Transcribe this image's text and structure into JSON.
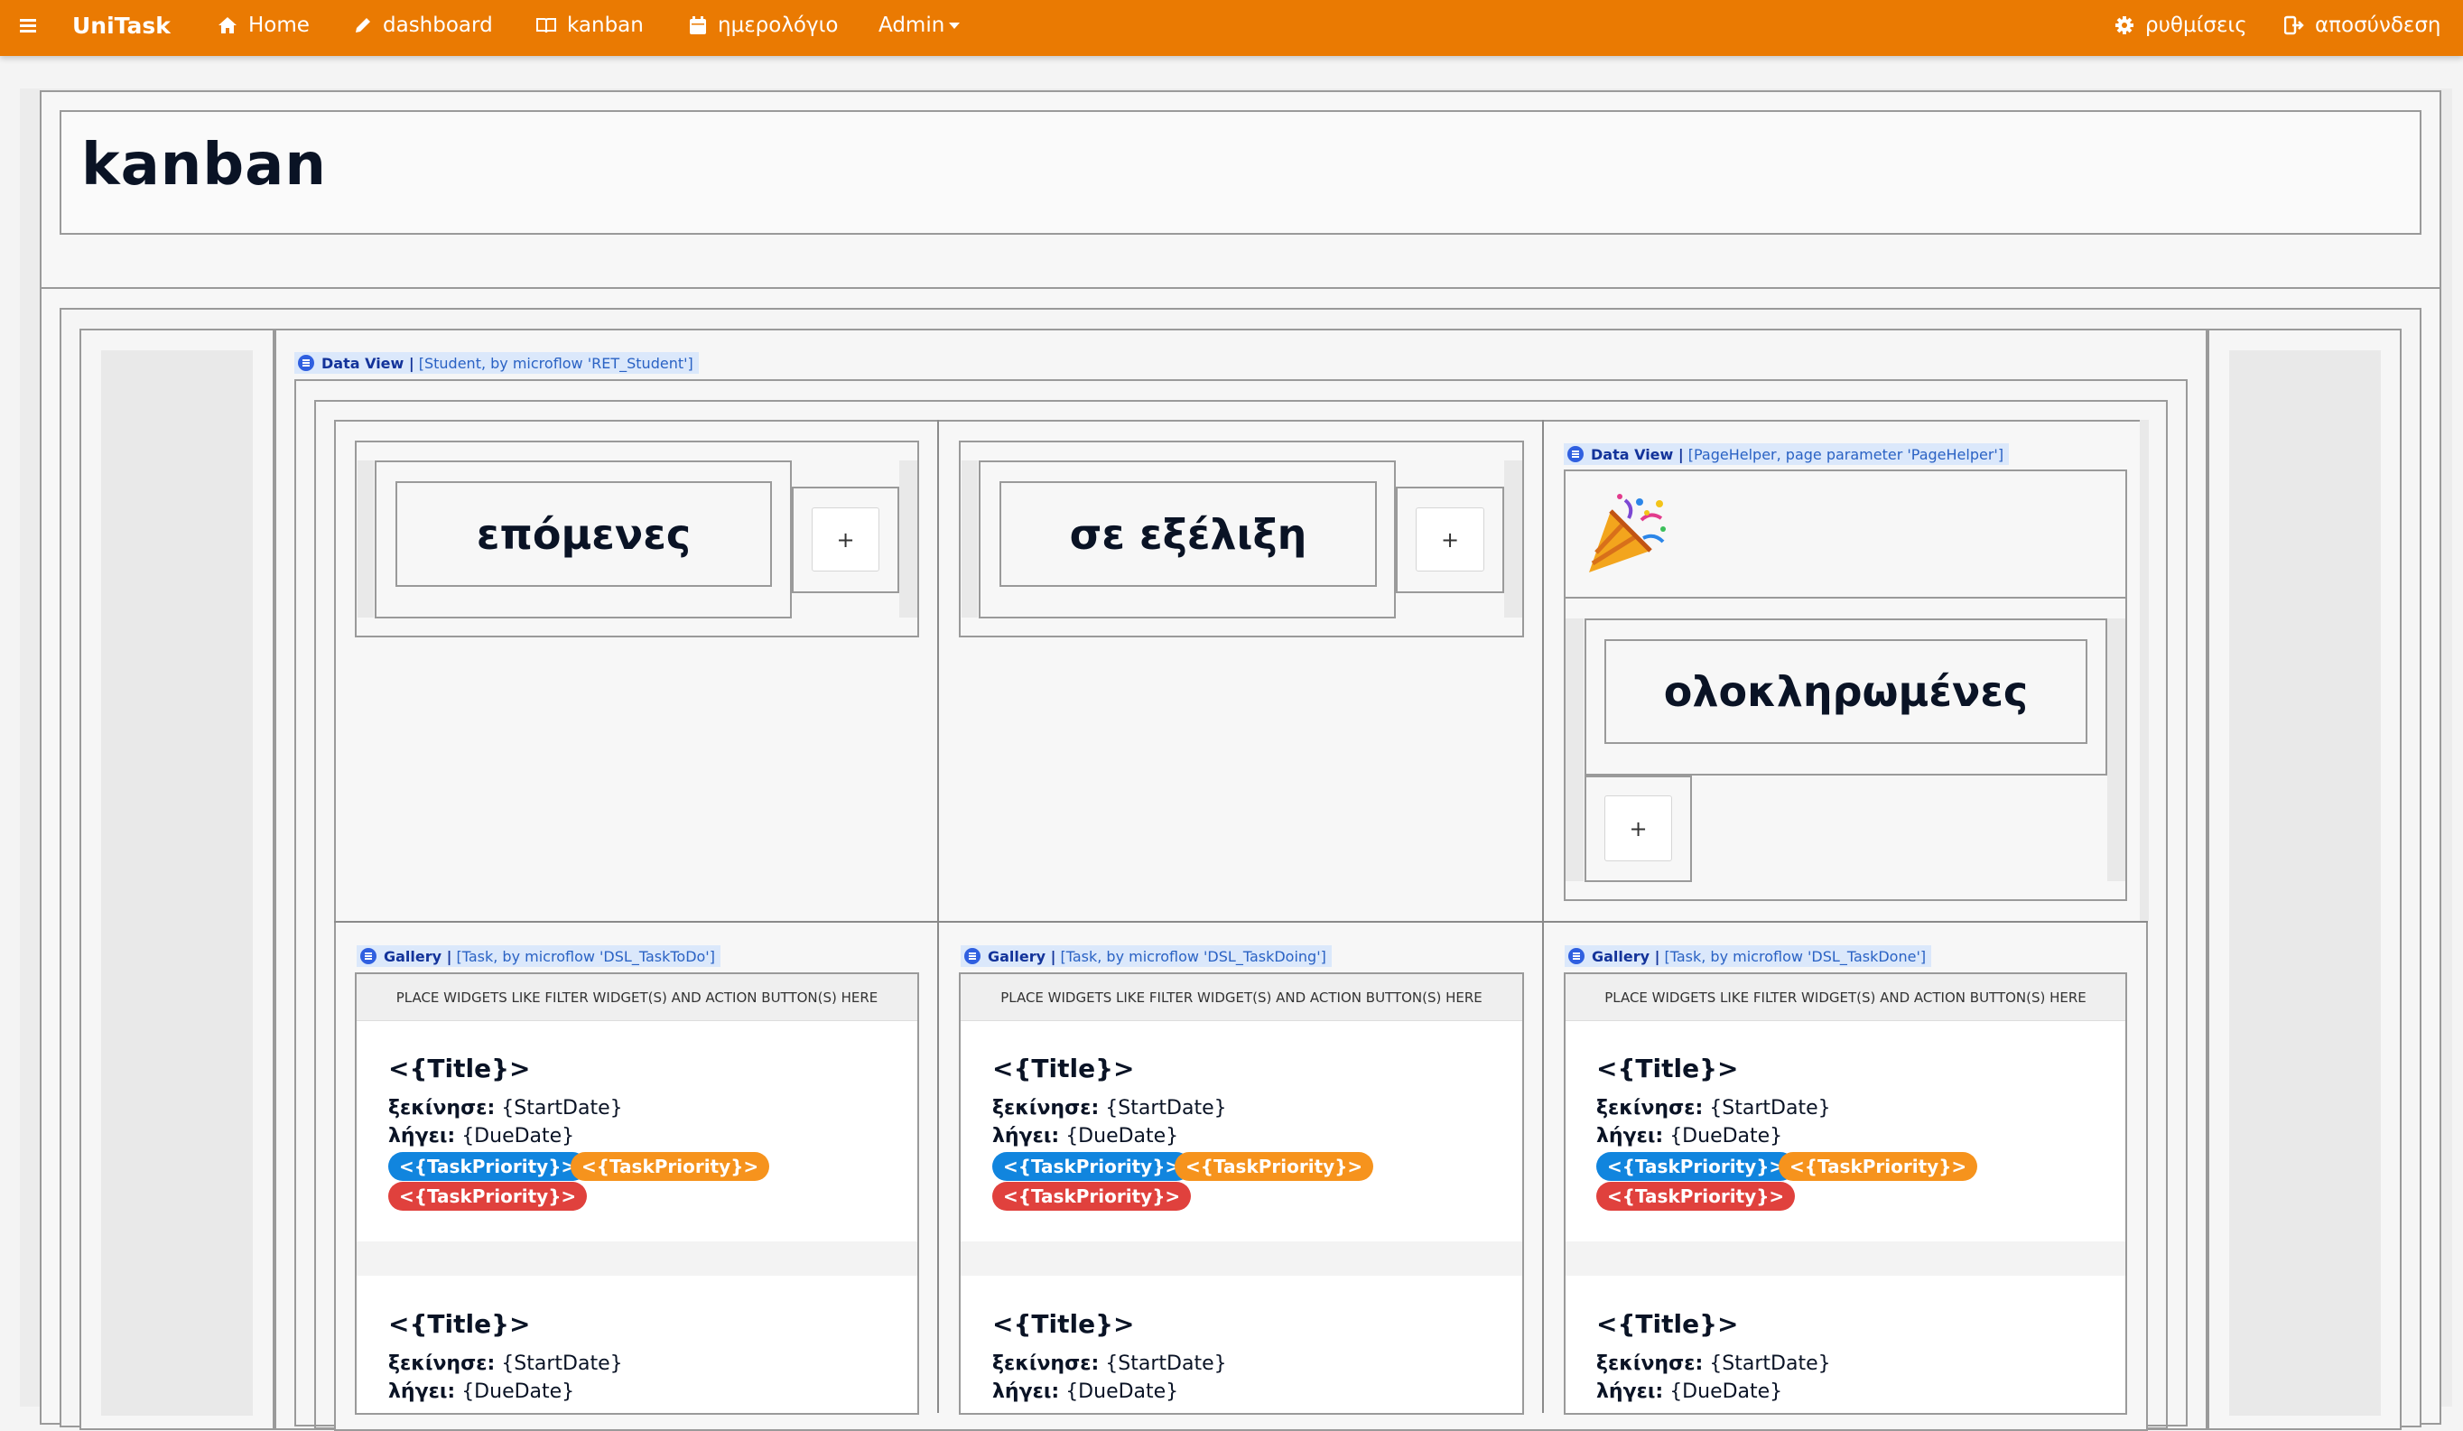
{
  "nav": {
    "menu_icon": "hamburger-icon",
    "brand": "UniTask",
    "home": "Home",
    "dashboard": "dashboard",
    "kanban": "kanban",
    "calendar": "ημερολόγιο",
    "admin": "Admin",
    "settings": "ρυθμίσεις",
    "logout": "αποσύνδεση"
  },
  "page": {
    "title": "kanban"
  },
  "dataview_student": {
    "kind": "Data View |",
    "source": "[Student, by microflow 'RET_Student']"
  },
  "dataview_pagehelper": {
    "kind": "Data View |",
    "source": "[PageHelper, page parameter 'PageHelper']"
  },
  "columns": [
    {
      "title": "επόμενες",
      "add_label": "+",
      "gallery_kind": "Gallery |",
      "gallery_source": "[Task, by microflow 'DSL_TaskToDo']"
    },
    {
      "title": "σε εξέλιξη",
      "add_label": "+",
      "gallery_kind": "Gallery |",
      "gallery_source": "[Task, by microflow 'DSL_TaskDoing']"
    },
    {
      "title": "ολοκληρωμένες",
      "add_label": "+",
      "gallery_kind": "Gallery |",
      "gallery_source": "[Task, by microflow 'DSL_TaskDone']"
    }
  ],
  "celebration_icon": "party-popper-icon",
  "gallery_header": "PLACE WIDGETS LIKE FILTER WIDGET(S) AND ACTION BUTTON(S) HERE",
  "card": {
    "title": "<{Title}>",
    "start_label": "ξεκίνησε:",
    "start_value": "{StartDate}",
    "due_label": "λήγει:",
    "due_value": "{DueDate}",
    "priority": "<{TaskPriority}>"
  },
  "colors": {
    "accent": "#ea7a02",
    "priority_blue": "#1185de",
    "priority_orange": "#f6931d",
    "priority_red": "#e0413d"
  }
}
